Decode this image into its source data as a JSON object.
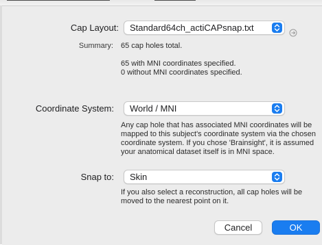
{
  "cap_layout": {
    "label": "Cap Layout:",
    "value": "Standard64ch_actiCAPsnap.txt",
    "info_icon": "info-circle-icon"
  },
  "summary": {
    "label": "Summary:",
    "line1": "65 cap holes total.",
    "line2": "65 with MNI coordinates specified.",
    "line3": "0 without MNI coordinates specified."
  },
  "coordinate_system": {
    "label": "Coordinate System:",
    "value": "World / MNI",
    "help": "Any cap hole that has associated MNI coordinates will be mapped to this subject's coordinate system via the chosen coordinate system. If you chose 'Brainsight', it is assumed your anatomical dataset itself is in MNI space."
  },
  "snap_to": {
    "label": "Snap to:",
    "value": "Skin",
    "help": "If you also select a reconstruction, all cap holes will be moved to the nearest point on it."
  },
  "buttons": {
    "cancel": "Cancel",
    "ok": "OK"
  },
  "colors": {
    "accent": "#1a7df0",
    "sheet_bg": "#ececec"
  }
}
